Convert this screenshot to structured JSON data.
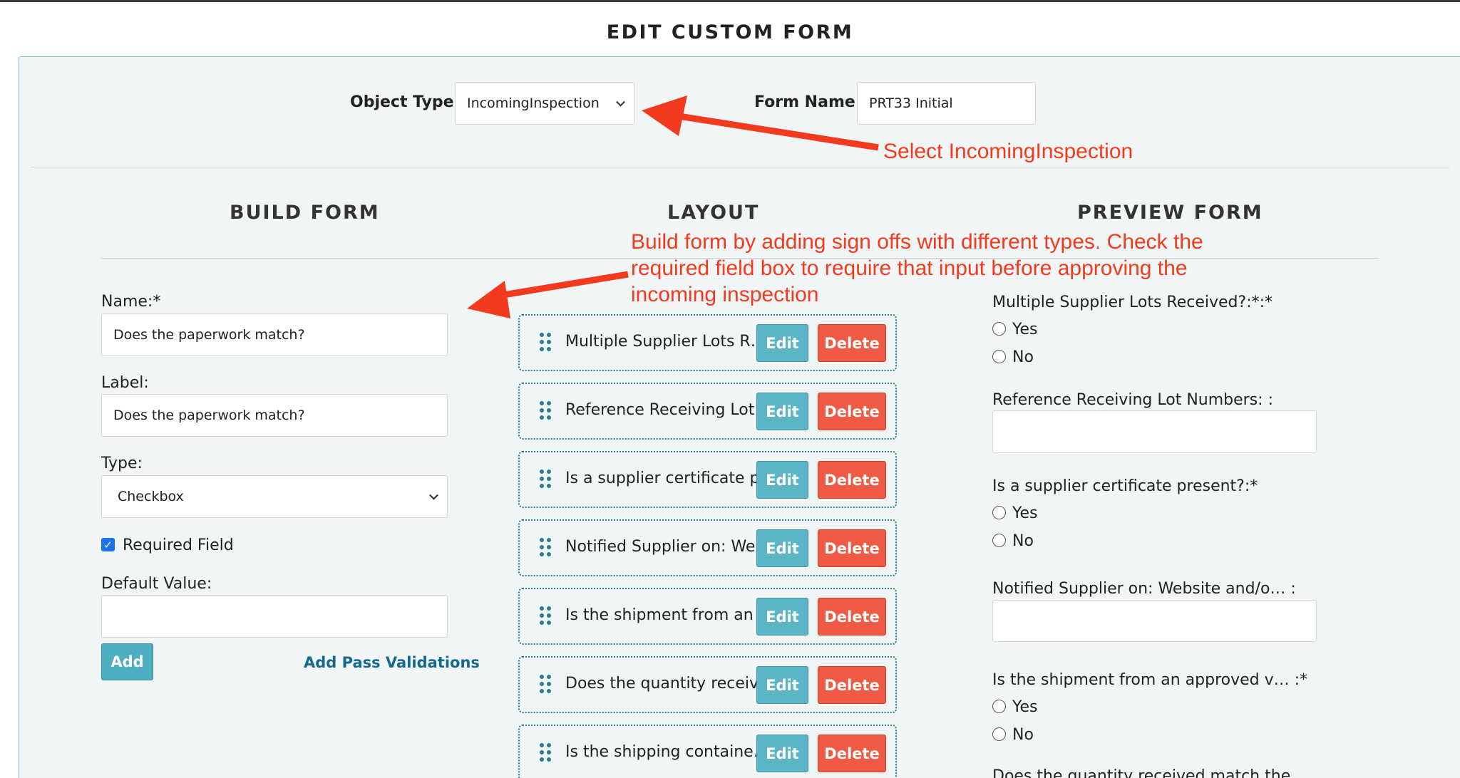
{
  "page": {
    "title": "EDIT CUSTOM FORM"
  },
  "header_form": {
    "object_type_label": "Object Type",
    "object_type_value": "IncomingInspection",
    "form_name_label": "Form Name",
    "form_name_value": "PRT33 Initial"
  },
  "sections": {
    "build": "BUILD FORM",
    "layout": "LAYOUT",
    "preview": "PREVIEW FORM"
  },
  "build_form": {
    "name_label": "Name:*",
    "name_value": "Does the paperwork match?",
    "label_label": "Label:",
    "label_value": "Does the paperwork match?",
    "type_label": "Type:",
    "type_value": "Checkbox",
    "required_label": "Required Field",
    "required_checked": true,
    "default_label": "Default Value:",
    "default_value": "",
    "add_button": "Add",
    "add_pass_validations": "Add Pass Validations"
  },
  "layout_rows": [
    {
      "text": "Multiple Supplier Lots R…",
      "edit": "Edit",
      "delete": "Delete"
    },
    {
      "text": "Reference Receiving Lot …",
      "edit": "Edit",
      "delete": "Delete"
    },
    {
      "text": "Is a supplier certificate p…",
      "edit": "Edit",
      "delete": "Delete"
    },
    {
      "text": "Notified Supplier on: We…",
      "edit": "Edit",
      "delete": "Delete"
    },
    {
      "text": "Is the shipment from an …",
      "edit": "Edit",
      "delete": "Delete"
    },
    {
      "text": "Does the quantity receiv…",
      "edit": "Edit",
      "delete": "Delete"
    },
    {
      "text": "Is the shipping containe…",
      "edit": "Edit",
      "delete": "Delete"
    }
  ],
  "preview": {
    "q1_label": "Multiple Supplier Lots Received?:*:*",
    "q2_label": "Reference Receiving Lot Numbers: :",
    "q3_label": "Is a supplier certificate present?:*",
    "q4_label": "Notified Supplier on: Website and/o… :",
    "q5_label": "Is the shipment from an approved v… :*",
    "q6_label": "Does the quantity received match the",
    "yes": "Yes",
    "no": "No"
  },
  "annotations": {
    "select_note": "Select IncomingInspection",
    "build_note_line1": "Build form by adding sign offs with different types. Check the",
    "build_note_line2": "required field box to require that input before approving the",
    "build_note_line3": "incoming inspection"
  },
  "colors": {
    "panel_bg": "#f1f5f6",
    "panel_border": "#7fc3cc",
    "edit_button": "#5bb5c6",
    "delete_button": "#ef5a44",
    "annotation_red": "#f23b1e",
    "link": "#14698f"
  }
}
